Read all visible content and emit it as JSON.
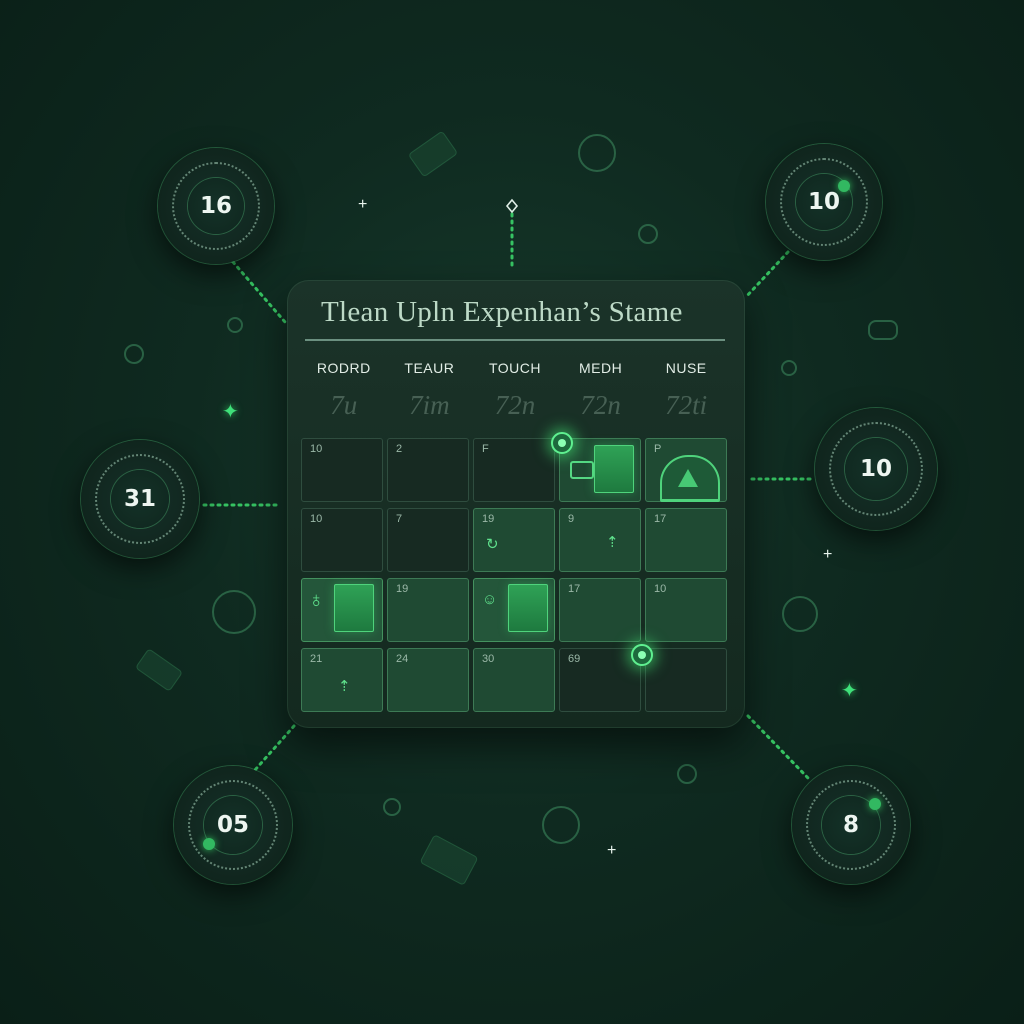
{
  "calendar": {
    "title": "Tlean Upln Expenhan’s Stame",
    "weekdays": [
      "RODRD",
      "TEAUR",
      "TOUCH",
      "MEDH",
      "NUSE"
    ],
    "dates": [
      "7u",
      "7im",
      "72n",
      "72n",
      "72ti"
    ],
    "cells": [
      {
        "num": "10"
      },
      {
        "num": "2"
      },
      {
        "num": "F"
      },
      {
        "num": ""
      },
      {
        "num": "P"
      },
      {
        "num": "10"
      },
      {
        "num": "7"
      },
      {
        "num": "19"
      },
      {
        "num": "9"
      },
      {
        "num": "17"
      },
      {
        "num": ""
      },
      {
        "num": "19"
      },
      {
        "num": ""
      },
      {
        "num": "17"
      },
      {
        "num": "10"
      },
      {
        "num": "21"
      },
      {
        "num": "24"
      },
      {
        "num": "30"
      },
      {
        "num": "69"
      },
      {
        "num": ""
      }
    ]
  },
  "badges": {
    "top_left": "16",
    "top_right": "10",
    "mid_left": "31",
    "mid_right": "10",
    "bottom_left": "05",
    "bottom_right": "8"
  },
  "colors": {
    "accent": "#3bd46a",
    "background": "#0f2a20",
    "card": "#172a22"
  },
  "icons": [
    "calendar-pin-icon",
    "dome-event-icon",
    "arrow-up-icon",
    "sparkle-icon"
  ]
}
